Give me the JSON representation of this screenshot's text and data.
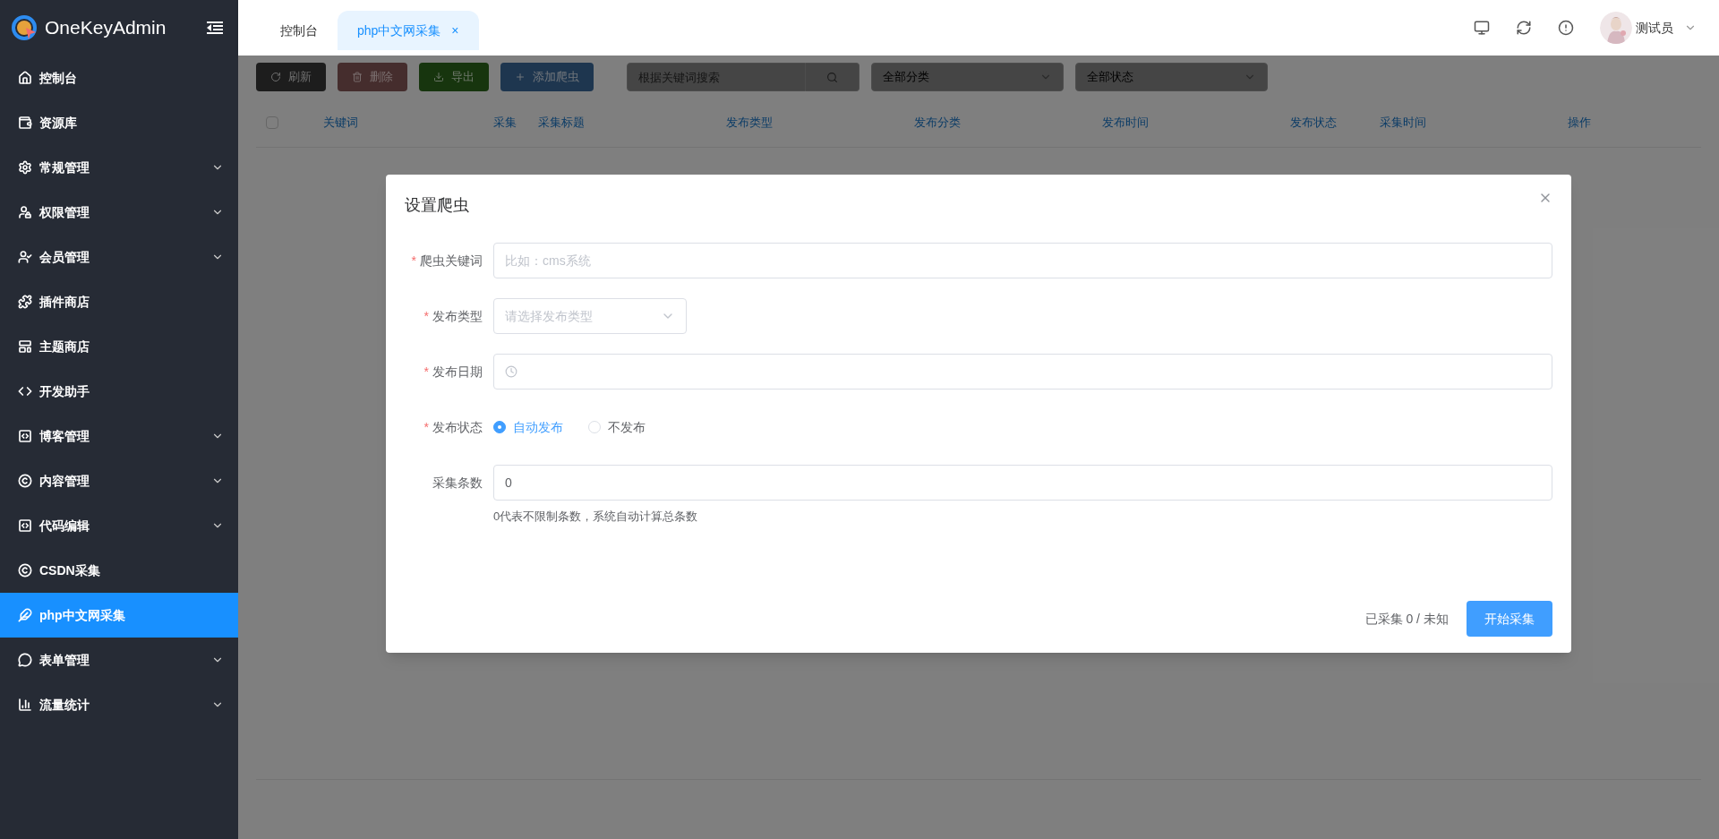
{
  "brand": {
    "name": "OneKeyAdmin"
  },
  "tabs": [
    {
      "label": "控制台",
      "selected": false
    },
    {
      "label": "php中文网采集",
      "selected": true,
      "close": "×"
    }
  ],
  "user": {
    "name": "测试员"
  },
  "sidebar": {
    "items": [
      {
        "label": "控制台",
        "expandable": false,
        "selected": false
      },
      {
        "label": "资源库",
        "expandable": false,
        "selected": false
      },
      {
        "label": "常规管理",
        "expandable": true,
        "selected": false
      },
      {
        "label": "权限管理",
        "expandable": true,
        "selected": false
      },
      {
        "label": "会员管理",
        "expandable": true,
        "selected": false
      },
      {
        "label": "插件商店",
        "expandable": false,
        "selected": false
      },
      {
        "label": "主题商店",
        "expandable": false,
        "selected": false
      },
      {
        "label": "开发助手",
        "expandable": false,
        "selected": false
      },
      {
        "label": "博客管理",
        "expandable": true,
        "selected": false
      },
      {
        "label": "内容管理",
        "expandable": true,
        "selected": false
      },
      {
        "label": "代码编辑",
        "expandable": true,
        "selected": false
      },
      {
        "label": "CSDN采集",
        "expandable": false,
        "selected": false
      },
      {
        "label": "php中文网采集",
        "expandable": false,
        "selected": true
      },
      {
        "label": "表单管理",
        "expandable": true,
        "selected": false
      },
      {
        "label": "流量统计",
        "expandable": true,
        "selected": false
      }
    ]
  },
  "toolbar": {
    "buttons": [
      {
        "label": "刷新",
        "kind": "dark"
      },
      {
        "label": "删除",
        "kind": "danger"
      },
      {
        "label": "导出",
        "kind": "success"
      },
      {
        "label": "添加爬虫",
        "kind": "primary"
      }
    ],
    "search": {
      "placeholder": "根据关键词搜索"
    },
    "filters": [
      {
        "value": "全部分类"
      },
      {
        "value": "全部状态"
      }
    ]
  },
  "table": {
    "select_all": {
      "checked": false
    },
    "columns": [
      "关键词",
      "采集",
      "采集标题",
      "发布类型",
      "发布分类",
      "发布时间",
      "发布状态",
      "采集时间",
      "操作"
    ]
  },
  "dialog": {
    "title": "设置爬虫",
    "fields": [
      {
        "kind": "text",
        "label": "爬虫关键词",
        "required_mark": "*",
        "placeholder": "比如：cms系统"
      },
      {
        "kind": "select",
        "label": "发布类型",
        "required_mark": "*",
        "placeholder": "请选择发布类型"
      },
      {
        "kind": "date",
        "label": "发布日期",
        "required_mark": "*"
      },
      {
        "kind": "radio",
        "label": "发布状态",
        "required_mark": "*",
        "options": [
          {
            "label": "自动发布",
            "selected": true
          },
          {
            "label": "不发布",
            "selected": false
          }
        ]
      },
      {
        "kind": "number",
        "label": "采集条数",
        "value": "0",
        "help": "0代表不限制条数，系统自动计算总条数"
      }
    ],
    "progress": "已采集 0 /",
    "total": "未知",
    "submit": "开始采集"
  }
}
